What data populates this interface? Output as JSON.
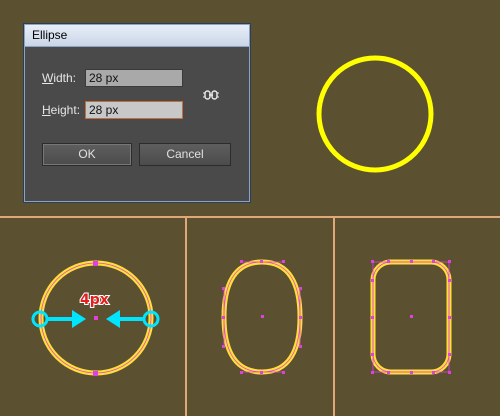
{
  "dialog": {
    "title": "Ellipse",
    "width_label_hotkey": "W",
    "width_label_rest": "idth:",
    "width_value": "28 px",
    "height_label_hotkey": "H",
    "height_label_rest": "eight:",
    "height_value": "28 px",
    "ok_label": "OK",
    "cancel_label": "Cancel"
  },
  "annotation": {
    "text": "4px"
  },
  "colors": {
    "artboard": "#5b5130",
    "shape_stroke": "#ffff00",
    "anchor": "#e040e0",
    "arrow": "#00e5ff",
    "annotation": "#e02020",
    "divider": "#e0a878"
  },
  "icons": {
    "constrain": "link-icon"
  }
}
